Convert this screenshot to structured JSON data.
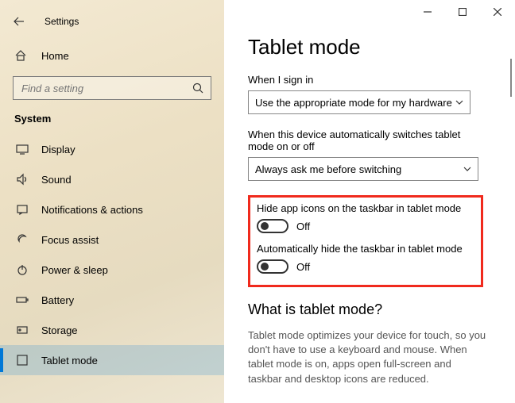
{
  "window": {
    "title": "Settings"
  },
  "sidebar": {
    "home": "Home",
    "search_placeholder": "Find a setting",
    "group": "System",
    "items": [
      {
        "label": "Display"
      },
      {
        "label": "Sound"
      },
      {
        "label": "Notifications & actions"
      },
      {
        "label": "Focus assist"
      },
      {
        "label": "Power & sleep"
      },
      {
        "label": "Battery"
      },
      {
        "label": "Storage"
      },
      {
        "label": "Tablet mode"
      }
    ]
  },
  "main": {
    "title": "Tablet mode",
    "signin_label": "When I sign in",
    "signin_value": "Use the appropriate mode for my hardware",
    "autoswitch_label": "When this device automatically switches tablet mode on or off",
    "autoswitch_value": "Always ask me before switching",
    "toggle1_label": "Hide app icons on the taskbar in tablet mode",
    "toggle1_state": "Off",
    "toggle2_label": "Automatically hide the taskbar in tablet mode",
    "toggle2_state": "Off",
    "subheading": "What is tablet mode?",
    "description": "Tablet mode optimizes your device for touch, so you don't have to use a keyboard and mouse. When tablet mode is on, apps open full-screen and taskbar and desktop icons are reduced."
  }
}
